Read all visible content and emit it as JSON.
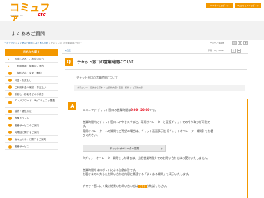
{
  "header": {
    "logo_text": "コミュファ",
    "logo_sub": "Operated by",
    "logo_brand": "ctc",
    "web_login_label": "Webホームログイン",
    "my_login_label": "Myコミュファログイン"
  },
  "page": {
    "title": "よくあるご質問"
  },
  "breadcrumb": {
    "items": [
      "コミュファ",
      "よくあるご質問",
      "よくある質問",
      "チャット窓口の営業時間について"
    ]
  },
  "font_size": {
    "label": "文字サイズ変更",
    "small": "小",
    "medium": "中",
    "large": "大"
  },
  "sidebar": {
    "heading": "目的から探す",
    "items": [
      {
        "label": "お申し込み・ご検討中の方",
        "icon": "arrow"
      },
      {
        "label": "ご利用開始・機器のご案内",
        "icon": "arrow"
      },
      {
        "label": "ご契約内容・変更・解約",
        "icon": "dot"
      },
      {
        "label": "料金・お支払い",
        "icon": "dot"
      },
      {
        "label": "ご利用料金の確認・お支払い",
        "icon": "dot"
      },
      {
        "label": "引越し・移転などの手続き",
        "icon": "dot"
      },
      {
        "label": "ID・パスワード・Myコミュファ関連",
        "icon": "dot"
      },
      {
        "label": "接続・通信方法",
        "icon": "dot"
      },
      {
        "label": "各種トラブル",
        "icon": "dot"
      },
      {
        "label": "各種サービスのご案内",
        "icon": "dot"
      },
      {
        "label": "光電話に関するご案内",
        "icon": "dot"
      },
      {
        "label": "セキュリティに関するご案内",
        "icon": "dot"
      },
      {
        "label": "各種サービス",
        "icon": "dot"
      }
    ]
  },
  "toolbar": {
    "back_label": "◀ 戻る",
    "id_label": "印刷  |  ID：2436",
    "print_icon": "print-icon",
    "bookmark_icon": "bookmark-icon"
  },
  "question": {
    "badge": "Q",
    "title": "チャット窓口の営業時間について",
    "body": "チャット窓口の営業時間について",
    "category": "カテゴリー：  目的から探す  ＞  ご契約内容・変更・解約  ＞  ご契約内容"
  },
  "answer": {
    "badge": "A",
    "line1_pre": "コミュファ チャット窓口の営業時間は",
    "line1_em": "9:00〜20:00",
    "line1_post": "です。",
    "line2": "営業時間内にチャット窓口へアクセスすると、専用オペレーターと直接チャットでのやり取りが可能で",
    "line3": "す。",
    "line4": "専用オペレーターへの質問をご希望の場合は、チャット画面表示後【チャットオペレーター質問】をお選",
    "line5": "びください。",
    "operator_button": "チャットオペレーター質問",
    "line6": "※チャットオペレーター質問をした場合は、上記営業時間外でのお問い合わせはお受けいたしません。",
    "line7": "営業時間外はロボットによる自動応答です。",
    "line8": "お客さまの入力したお問い合わせ内容に関連する「よくある質問」を表示いたします。",
    "line9_pre": "チャット窓口にて検討結果のお問い合わせは",
    "line9_badge": "こちら",
    "line9_post": "が確認ください。"
  },
  "colors": {
    "accent": "#f39800",
    "brand_red": "#e60012",
    "link": "#2a6fb0"
  }
}
